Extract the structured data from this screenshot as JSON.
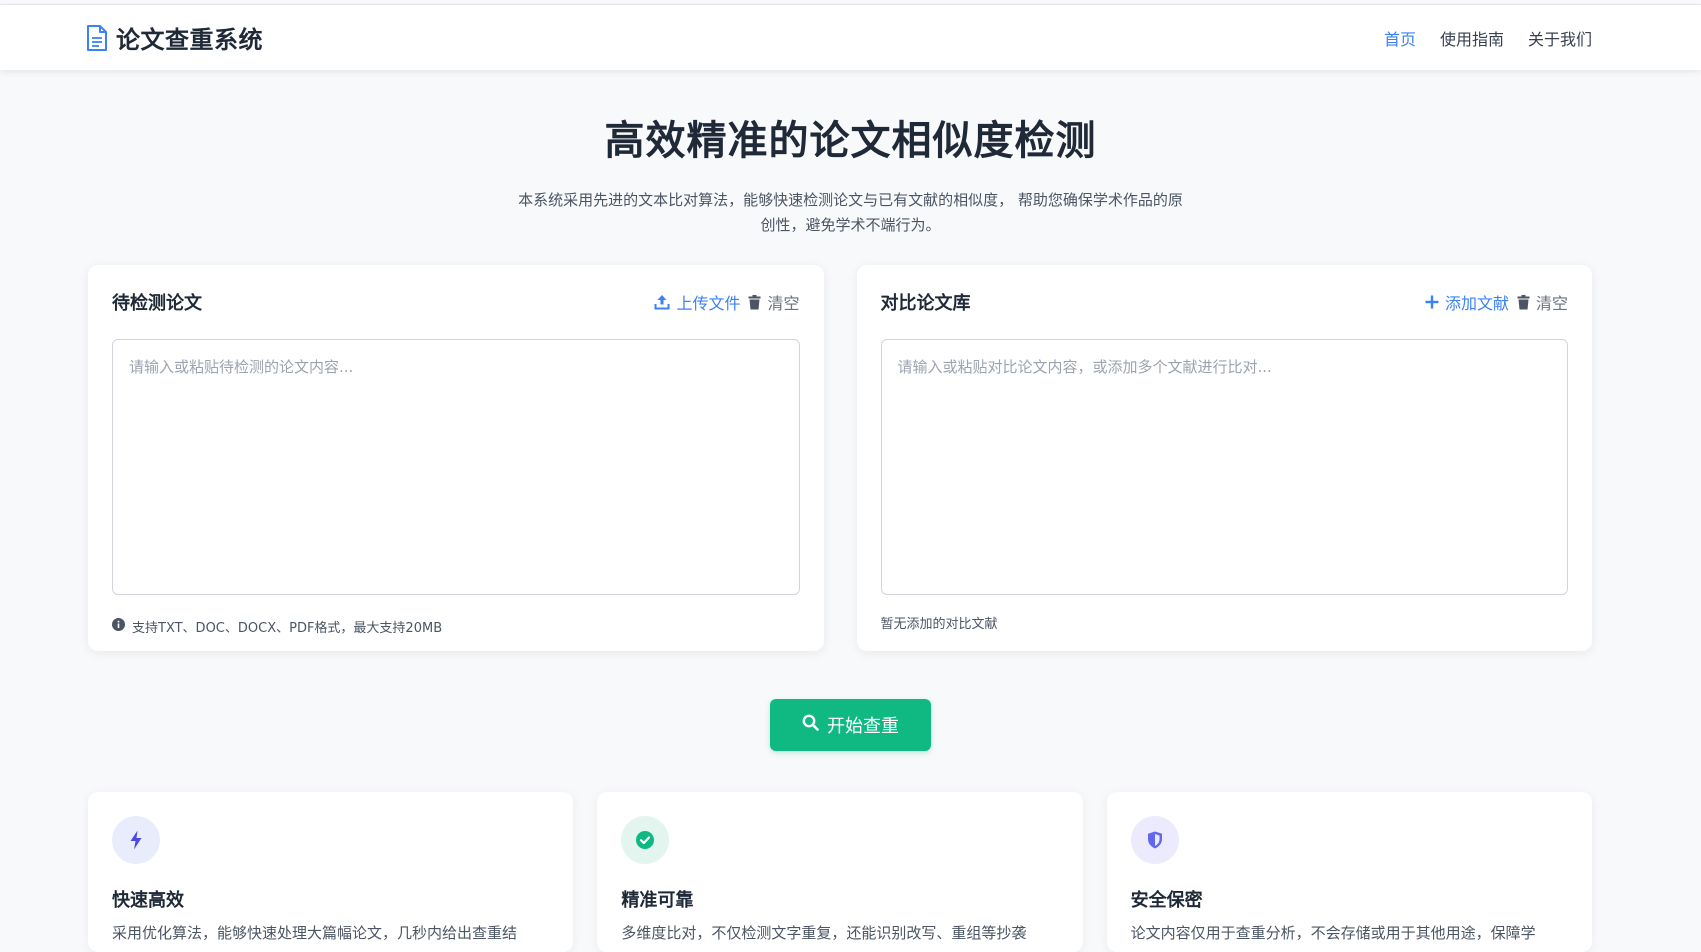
{
  "navbar": {
    "brand_title": "论文查重系统",
    "links": [
      "首页",
      "使用指南",
      "关于我们"
    ],
    "active_index": 0
  },
  "hero": {
    "title": "高效精准的论文相似度检测",
    "description": "本系统采用先进的文本比对算法，能够快速检测论文与已有文献的相似度， 帮助您确保学术作品的原创性，避免学术不端行为。"
  },
  "left_panel": {
    "title": "待检测论文",
    "upload_label": "上传文件",
    "clear_label": "清空",
    "placeholder": "请输入或粘贴待检测的论文内容...",
    "footnote": "支持TXT、DOC、DOCX、PDF格式，最大支持20MB"
  },
  "right_panel": {
    "title": "对比论文库",
    "add_label": "添加文献",
    "clear_label": "清空",
    "placeholder": "请输入或粘贴对比论文内容，或添加多个文献进行比对...",
    "footnote": "暂无添加的对比文献"
  },
  "start_button": {
    "label": "开始查重"
  },
  "features": [
    {
      "title": "快速高效",
      "description": "采用优化算法，能够快速处理大篇幅论文，几秒内给出查重结",
      "icon": "lightning-icon",
      "color": "#4f46e5",
      "bg": "#e8edfb"
    },
    {
      "title": "精准可靠",
      "description": "多维度比对，不仅检测文字重复，还能识别改写、重组等抄袭",
      "icon": "check-circle-icon",
      "color": "#10b981",
      "bg": "#e3f5ee"
    },
    {
      "title": "安全保密",
      "description": "论文内容仅用于查重分析，不会存储或用于其他用途，保障学",
      "icon": "shield-icon",
      "color": "#6366f1",
      "bg": "#eceafd"
    }
  ],
  "colors": {
    "accent": "#3b82f6",
    "primary_button": "#10b981",
    "text": "#1f2937"
  }
}
